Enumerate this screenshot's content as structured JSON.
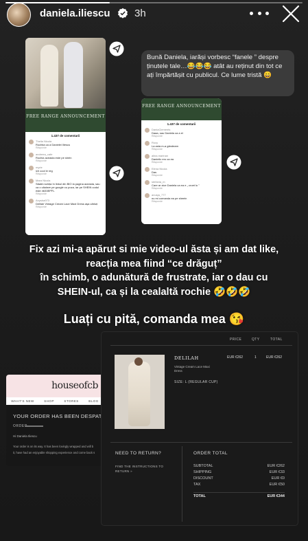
{
  "story": {
    "progress": 0.35,
    "username": "daniela.iliescu",
    "time": "3h"
  },
  "card_left": {
    "banner_text": "FREE RANGE ANNOUNCEMENT",
    "comments_header": "1.437 de comentarii",
    "comments": [
      {
        "user": "Thelia Nicola",
        "text": "Rochița ca a Danielei Iliescu",
        "meta": "Răspunde"
      },
      {
        "user": "andreea_cafe",
        "text": "Rochia aceasta este pe shein",
        "meta": "Răspunde"
      },
      {
        "user": "myrie",
        "text": "ich cool le reg",
        "meta": "Răspunde"
      },
      {
        "user": "Mara Nicola",
        "text": "Săală rochița în linkul din BIO la pagina aceasta, sau ca o căutare pe google cu poza, iar pe SHEIN codul este 4633EPFL",
        "meta": "Răspunde"
      },
      {
        "user": "Anysha973",
        "text": "Delilah Vintage Cream Lace Maxi Dress aşa cărluți",
        "meta": "Răspunde"
      }
    ]
  },
  "card_mid": {
    "banner_text": "FREE RANGE ANNOUNCEMENT",
    "comments_header": "1.437 de comentarii",
    "comments": [
      {
        "user": "DaniaClements",
        "text": "Daaa, sau Daniela ca a ei",
        "meta": "Răspunde"
      },
      {
        "user": "Roxy",
        "text": "La asta m-a gândeam",
        "meta": "Răspunde"
      },
      {
        "user": "alina.marinan",
        "text": "Danielix ero ca ea",
        "meta": "Răspunde"
      },
      {
        "user": "Elena Nicola",
        "text": "Das",
        "meta": "Răspunde"
      },
      {
        "user": "stefania_m",
        "text": "Care ar zice Daniela ca ea e „ croet lu ”",
        "meta": "Răspunde"
      },
      {
        "user": "anusja_777",
        "text": "nu mi comanda ea pe sheein",
        "meta": "Răspunde"
      }
    ]
  },
  "bubble": {
    "text": "Bună Daniela, iarăși vorbesc “fanele ” despre ținutele tale…😂😂😂 atât au reținut din tot ce ați împărtășit cu publicul. Ce lume tristă 😄"
  },
  "captions": {
    "line1": "Fix azi mi-a apărut si mie video-ul ăsta și am dat like, reacția mea fiind “ce drăguț”",
    "line2": "în schimb, o adunătură de frustrate, iar o dau cu SHEIN-ul, ca și la cealaltă rochie 🤣🤣🤣",
    "line3": "Luați cu pită, comanda mea 😘"
  },
  "email": {
    "logo": "houseofcb",
    "nav": [
      "WHAT'S NEW",
      "SHOP",
      "STORES",
      "BLOG"
    ],
    "title": "YOUR ORDER HAS BEEN DESPATCHED",
    "order_label": "ORDER",
    "greeting": "Hi Daniela Iliescu",
    "body_line1": "Your order is on its way. It has been lovingly wrapped and will b",
    "body_line2": "it, have had an enjoyable shopping experience and come back s"
  },
  "order": {
    "headers": {
      "price": "PRICE",
      "qty": "QTY",
      "total": "TOTAL"
    },
    "product": {
      "name": "DELILAH",
      "description": "Vintage Cream Lace Maxi Dress",
      "size": "SIZE: L   (REGULAR CUP)",
      "price": "EUR €262",
      "qty": "1",
      "total": "EUR €262"
    },
    "return_title": "NEED TO RETURN?",
    "return_link": "FIND THE INSTRUCTIONS TO RETURN »",
    "summary_title": "ORDER TOTAL",
    "rows": [
      {
        "label": "SUBTOTAL",
        "value": "EUR €262"
      },
      {
        "label": "SHIPPING",
        "value": "EUR €33"
      },
      {
        "label": "DISCOUNT",
        "value": "EUR €0"
      },
      {
        "label": "TAX",
        "value": "EUR €50"
      }
    ],
    "total_label": "TOTAL",
    "total_value": "EUR €344"
  }
}
